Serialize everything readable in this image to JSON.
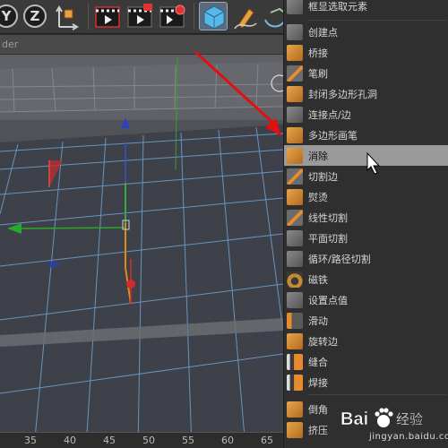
{
  "viewport": {
    "header_text": "der",
    "ruler_ticks": [
      "35",
      "40",
      "45",
      "50",
      "55",
      "60",
      "65"
    ]
  },
  "menu": {
    "top_item": "框显选取元素",
    "items": [
      {
        "label": "创建点",
        "icon": "create-point-icon"
      },
      {
        "label": "桥接",
        "icon": "bridge-icon"
      },
      {
        "label": "笔刷",
        "icon": "brush-icon"
      },
      {
        "label": "封闭多边形孔洞",
        "icon": "close-polygon-hole-icon"
      },
      {
        "label": "连接点/边",
        "icon": "connect-points-edges-icon"
      },
      {
        "label": "多边形画笔",
        "icon": "polygon-pen-icon"
      },
      {
        "label": "消除",
        "icon": "dissolve-icon",
        "active": true
      },
      {
        "label": "切割边",
        "icon": "edge-cut-icon"
      },
      {
        "label": "熨烫",
        "icon": "iron-icon"
      },
      {
        "label": "线性切割",
        "icon": "line-cut-icon"
      },
      {
        "label": "平面切割",
        "icon": "plane-cut-icon"
      },
      {
        "label": "循环/路径切割",
        "icon": "loop-path-cut-icon"
      },
      {
        "label": "磁铁",
        "icon": "magnet-icon"
      },
      {
        "label": "设置点值",
        "icon": "set-point-value-icon"
      },
      {
        "label": "滑动",
        "icon": "slide-icon"
      },
      {
        "label": "旋转边",
        "icon": "spin-edge-icon"
      },
      {
        "label": "缝合",
        "icon": "stitch-and-sew-icon"
      },
      {
        "label": "焊接",
        "icon": "weld-icon"
      },
      {
        "label": "倒角",
        "icon": "bevel-icon"
      },
      {
        "label": "挤压",
        "icon": "extrude-icon"
      }
    ]
  },
  "watermark": {
    "logo_text": "Bai 经验",
    "sub_text": "jingyan.baidu.com"
  },
  "colors": {
    "arrow": "#e01010",
    "menu_bg": "#2f2f2f",
    "menu_active": "#9a9a9a",
    "grid_line": "#7fa8d8"
  }
}
